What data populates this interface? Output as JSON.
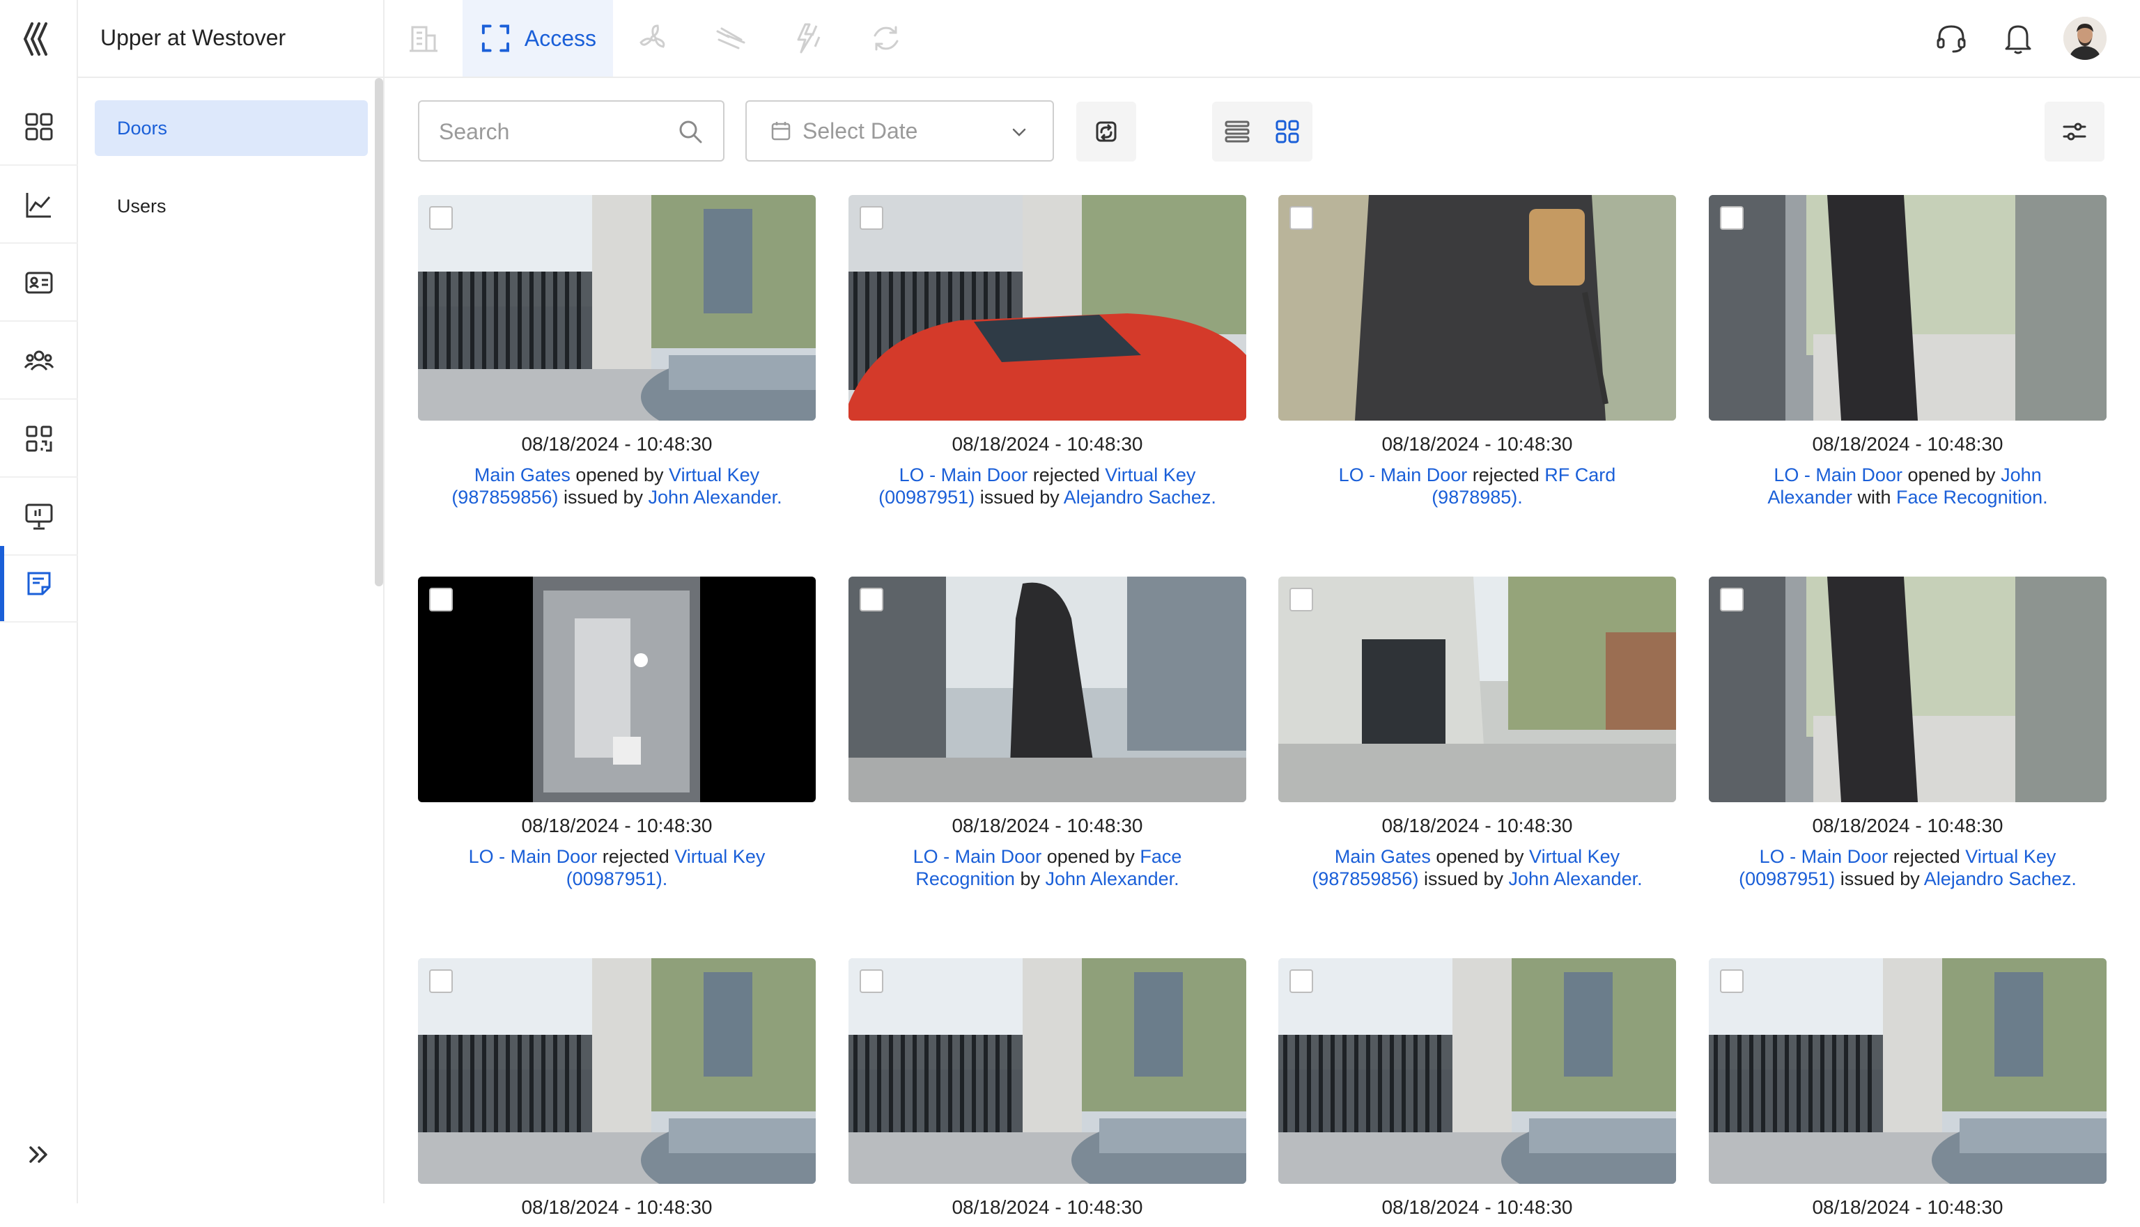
{
  "app": {
    "site_name": "Upper at Westover"
  },
  "colors": {
    "accent": "#1a5fd8",
    "active_bg": "#dde8fb"
  },
  "rail": {
    "items": [
      "dashboard-icon",
      "analytics-icon",
      "id-card-icon",
      "users-group-icon",
      "qr-code-icon",
      "monitor-icon",
      "notes-icon"
    ],
    "active": "notes-icon"
  },
  "sidebar": {
    "items": [
      {
        "label": "Doors",
        "active": true
      },
      {
        "label": "Users",
        "active": false
      }
    ]
  },
  "topbar": {
    "active_tab": "Access",
    "tabs": [
      "building-icon",
      "access-scan-icon",
      "fan-icon",
      "wind-icon",
      "energy-icon",
      "sync-icon"
    ],
    "right_icons": [
      "headset-icon",
      "bell-icon",
      "avatar"
    ]
  },
  "toolbar": {
    "search_placeholder": "Search",
    "date_placeholder": "Select Date"
  },
  "events": [
    {
      "timestamp": "08/18/2024 - 10:48:30",
      "parts": [
        [
          "Main Gates",
          true
        ],
        [
          " opened by ",
          false
        ],
        [
          "Virtual Key (987859856)",
          true
        ],
        [
          "  issued by ",
          false
        ],
        [
          "John Alexander.",
          true
        ]
      ]
    },
    {
      "timestamp": "08/18/2024 - 10:48:30",
      "parts": [
        [
          "LO - Main Door",
          true
        ],
        [
          " rejected ",
          false
        ],
        [
          "Virtual Key (00987951)",
          true
        ],
        [
          " issued by ",
          false
        ],
        [
          "Alejandro Sachez.",
          true
        ]
      ]
    },
    {
      "timestamp": "08/18/2024 - 10:48:30",
      "parts": [
        [
          "LO - Main Door",
          true
        ],
        [
          " rejected ",
          false
        ],
        [
          "RF Card (9878985).",
          true
        ]
      ]
    },
    {
      "timestamp": "08/18/2024 - 10:48:30",
      "parts": [
        [
          "LO - Main Door",
          true
        ],
        [
          " opened by ",
          false
        ],
        [
          "John Alexander",
          true
        ],
        [
          " with ",
          false
        ],
        [
          "Face Recognition.",
          true
        ]
      ]
    },
    {
      "timestamp": "08/18/2024 - 10:48:30",
      "parts": [
        [
          "LO - Main Door",
          true
        ],
        [
          " rejected ",
          false
        ],
        [
          "Virtual Key (00987951).",
          true
        ]
      ]
    },
    {
      "timestamp": "08/18/2024 - 10:48:30",
      "parts": [
        [
          "LO - Main Door",
          true
        ],
        [
          " opened by ",
          false
        ],
        [
          "Face Recognition",
          true
        ],
        [
          " by ",
          false
        ],
        [
          "John Alexander.",
          true
        ]
      ]
    },
    {
      "timestamp": "08/18/2024 - 10:48:30",
      "parts": [
        [
          "Main Gates",
          true
        ],
        [
          " opened by ",
          false
        ],
        [
          "Virtual Key (987859856)",
          true
        ],
        [
          "  issued by ",
          false
        ],
        [
          "John Alexander.",
          true
        ]
      ]
    },
    {
      "timestamp": "08/18/2024 - 10:48:30",
      "parts": [
        [
          "LO - Main Door",
          true
        ],
        [
          " rejected ",
          false
        ],
        [
          "Virtual Key (00987951)",
          true
        ],
        [
          " issued by ",
          false
        ],
        [
          "Alejandro Sachez.",
          true
        ]
      ]
    },
    {
      "timestamp": "08/18/2024 - 10:48:30",
      "parts": []
    },
    {
      "timestamp": "08/18/2024 - 10:48:30",
      "parts": []
    },
    {
      "timestamp": "08/18/2024 - 10:48:30",
      "parts": []
    },
    {
      "timestamp": "08/18/2024 - 10:48:30",
      "parts": []
    }
  ]
}
